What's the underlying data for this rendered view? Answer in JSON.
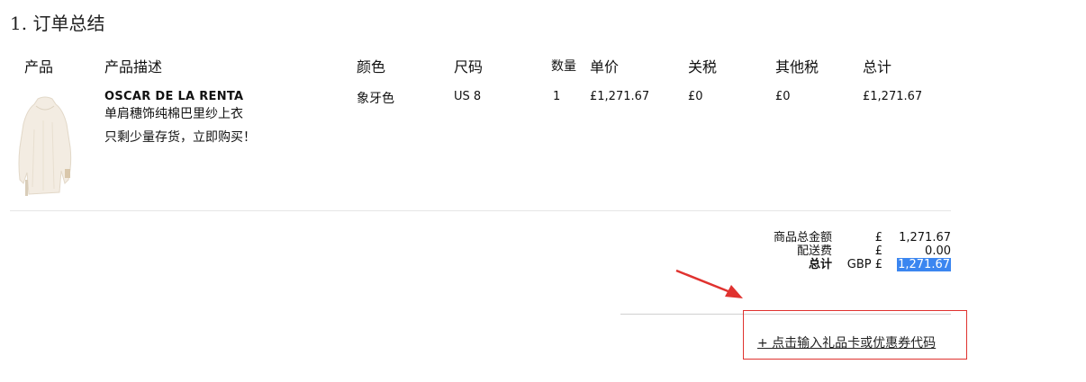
{
  "section": {
    "title": "1. 订单总结"
  },
  "table": {
    "headers": {
      "product": "产品",
      "description": "产品描述",
      "color": "颜色",
      "size": "尺码",
      "quantity": "数量",
      "unit_price": "单价",
      "duty": "关税",
      "other_tax": "其他税",
      "total": "总计"
    },
    "row": {
      "brand": "OSCAR DE LA RENTA",
      "name": "单肩穗饰纯棉巴里纱上衣",
      "stock_note": "只剩少量存货，立即购买！",
      "color": "象牙色",
      "size": "US 8",
      "quantity": "1",
      "unit_price": "£1,271.67",
      "duty": "£0",
      "other_tax": "£0",
      "total": "£1,271.67"
    }
  },
  "summary": {
    "subtotal_label": "商品总金额",
    "subtotal_currency": "£",
    "subtotal_value": "1,271.67",
    "shipping_label": "配送费",
    "shipping_currency": "£",
    "shipping_value": "0.00",
    "total_label": "总计",
    "total_currency": "GBP £",
    "total_value": "1,271.67"
  },
  "gift": {
    "link_label": "+ 点击输入礼品卡或优惠券代码"
  },
  "colors": {
    "highlight": "#3b86f0",
    "annotation_red": "#e0322f"
  },
  "icons": {
    "product_image": "blouse-image",
    "annotation": "red-arrow-icon"
  }
}
